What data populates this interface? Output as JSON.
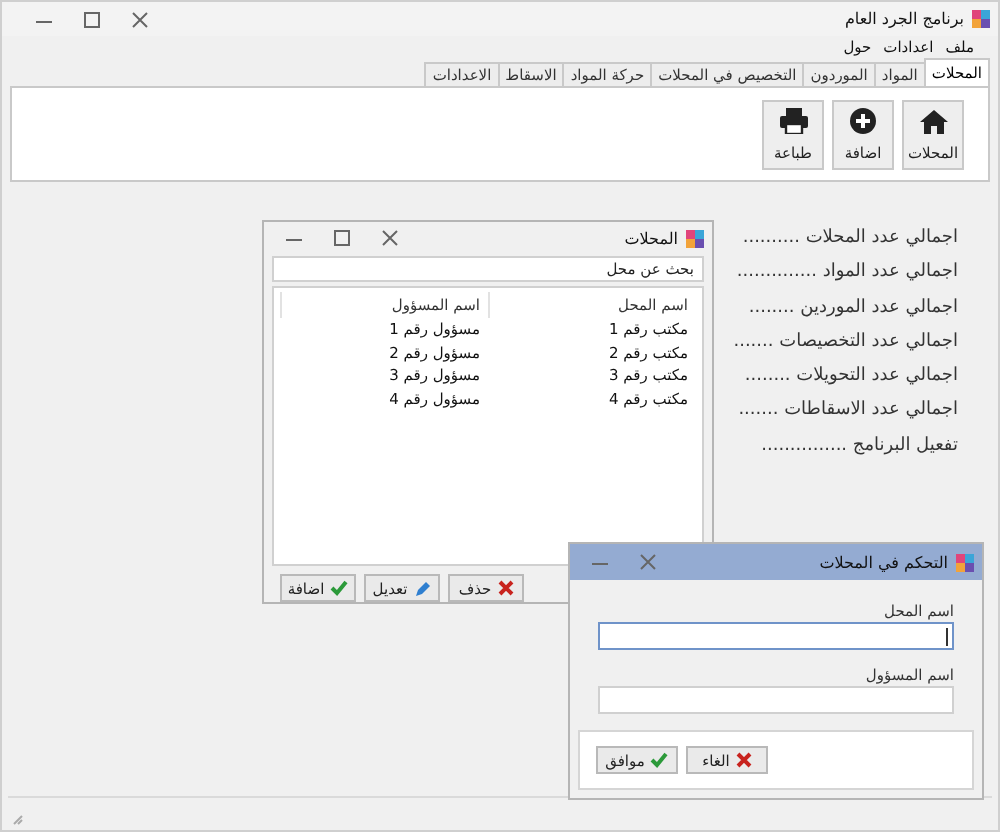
{
  "window": {
    "title": "برنامج الجرد العام"
  },
  "menu": [
    "ملف",
    "اعدادات",
    "حول"
  ],
  "tabs": [
    {
      "label": "المحلات",
      "selected": true
    },
    {
      "label": "المواد",
      "selected": false
    },
    {
      "label": "الموردون",
      "selected": false
    },
    {
      "label": "التخصيص في المحلات",
      "selected": false
    },
    {
      "label": "حركة المواد",
      "selected": false
    },
    {
      "label": "الاسقاط",
      "selected": false
    },
    {
      "label": "الاعدادات",
      "selected": false
    }
  ],
  "toolbar": [
    {
      "label": "المحلات",
      "kind": "home"
    },
    {
      "label": "اضافة",
      "kind": "add"
    },
    {
      "label": "طباعة",
      "kind": "print"
    }
  ],
  "stats": [
    "اجمالي عدد المحلات ..........",
    "اجمالي عدد المواد ..............",
    "اجمالي عدد الموردين ........",
    "اجمالي عدد التخصيصات .......",
    "اجمالي عدد التحويلات ........",
    "اجمالي عدد الاسقاطات .......",
    "تفعيل البرنامج ..............."
  ],
  "shops_window": {
    "title": "المحلات",
    "search": {
      "placeholder": "بحث عن محل"
    },
    "table": {
      "columns": [
        "اسم المحل",
        "اسم المسؤول"
      ],
      "rows": [
        [
          "مكتب رقم 1",
          "مسؤول رقم 1"
        ],
        [
          "مكتب رقم 2",
          "مسؤول رقم 2"
        ],
        [
          "مكتب رقم 3",
          "مسؤول رقم 3"
        ],
        [
          "مكتب رقم 4",
          "مسؤول رقم 4"
        ]
      ]
    },
    "buttons": [
      {
        "label": "حذف",
        "kind": "delete"
      },
      {
        "label": "تعديل",
        "kind": "edit"
      },
      {
        "label": "اضافة",
        "kind": "ok"
      }
    ]
  },
  "dialog": {
    "title": "التحكم في المحلات",
    "fields": [
      {
        "label": "اسم المحل",
        "focused": true
      },
      {
        "label": "اسم المسؤول",
        "focused": false
      }
    ],
    "buttons": [
      {
        "label": "الغاء",
        "kind": "delete"
      },
      {
        "label": "موافق",
        "kind": "ok"
      }
    ]
  }
}
